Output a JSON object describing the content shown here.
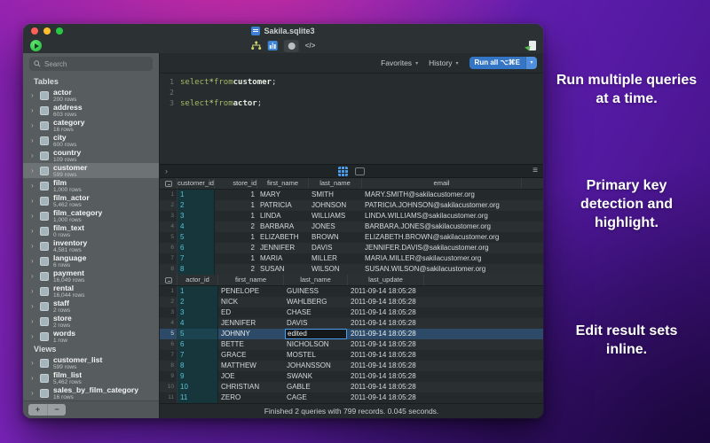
{
  "window": {
    "title": "Sakila.sqlite3"
  },
  "toolbar": {
    "code_label": "</>"
  },
  "query_toolbar": {
    "favorites_label": "Favorites",
    "history_label": "History",
    "run_all_label": "Run all ⌥⌘E",
    "dropdown_glyph": "▾"
  },
  "sidebar": {
    "search_placeholder": "Search",
    "footer": {
      "add_label": "+",
      "remove_label": "−"
    },
    "sections": [
      {
        "label": "Tables",
        "items": [
          {
            "name": "actor",
            "rows": "200 rows"
          },
          {
            "name": "address",
            "rows": "603 rows"
          },
          {
            "name": "category",
            "rows": "16 rows"
          },
          {
            "name": "city",
            "rows": "600 rows"
          },
          {
            "name": "country",
            "rows": "109 rows"
          },
          {
            "name": "customer",
            "rows": "599 rows",
            "selected": true
          },
          {
            "name": "film",
            "rows": "1,000 rows"
          },
          {
            "name": "film_actor",
            "rows": "5,462 rows"
          },
          {
            "name": "film_category",
            "rows": "1,000 rows"
          },
          {
            "name": "film_text",
            "rows": "0 rows"
          },
          {
            "name": "inventory",
            "rows": "4,581 rows"
          },
          {
            "name": "language",
            "rows": "6 rows"
          },
          {
            "name": "payment",
            "rows": "16,049 rows"
          },
          {
            "name": "rental",
            "rows": "16,044 rows"
          },
          {
            "name": "staff",
            "rows": "2 rows"
          },
          {
            "name": "store",
            "rows": "2 rows"
          },
          {
            "name": "words",
            "rows": "1 row"
          }
        ]
      },
      {
        "label": "Views",
        "items": [
          {
            "name": "customer_list",
            "rows": "599 rows"
          },
          {
            "name": "film_list",
            "rows": "5,462 rows"
          },
          {
            "name": "sales_by_film_category",
            "rows": "16 rows"
          }
        ]
      }
    ]
  },
  "editor": {
    "lines": [
      {
        "num": "1",
        "tokens": [
          {
            "text": "select ",
            "cls": "kw"
          },
          {
            "text": "* ",
            "cls": "op"
          },
          {
            "text": "from ",
            "cls": "kw"
          },
          {
            "text": "customer",
            "cls": "ident"
          },
          {
            "text": ";",
            "cls": "plain"
          }
        ]
      },
      {
        "num": "2",
        "tokens": []
      },
      {
        "num": "3",
        "tokens": [
          {
            "text": "select ",
            "cls": "kw"
          },
          {
            "text": "* ",
            "cls": "op"
          },
          {
            "text": "from ",
            "cls": "kw"
          },
          {
            "text": "actor",
            "cls": "ident"
          },
          {
            "text": ";",
            "cls": "plain"
          }
        ]
      }
    ]
  },
  "results_strip": {
    "chevron_glyph": "›",
    "hamburger_glyph": "≡"
  },
  "results": [
    {
      "columns": [
        "customer_id",
        "store_id",
        "first_name",
        "last_name",
        "email"
      ],
      "pk_column": 0,
      "rows": [
        [
          "1",
          "1",
          "MARY",
          "SMITH",
          "MARY.SMITH@sakilacustomer.org"
        ],
        [
          "2",
          "1",
          "PATRICIA",
          "JOHNSON",
          "PATRICIA.JOHNSON@sakilacustomer.org"
        ],
        [
          "3",
          "1",
          "LINDA",
          "WILLIAMS",
          "LINDA.WILLIAMS@sakilacustomer.org"
        ],
        [
          "4",
          "2",
          "BARBARA",
          "JONES",
          "BARBARA.JONES@sakilacustomer.org"
        ],
        [
          "5",
          "1",
          "ELIZABETH",
          "BROWN",
          "ELIZABETH.BROWN@sakilacustomer.org"
        ],
        [
          "6",
          "2",
          "JENNIFER",
          "DAVIS",
          "JENNIFER.DAVIS@sakilacustomer.org"
        ],
        [
          "7",
          "1",
          "MARIA",
          "MILLER",
          "MARIA.MILLER@sakilacustomer.org"
        ],
        [
          "8",
          "2",
          "SUSAN",
          "WILSON",
          "SUSAN.WILSON@sakilacustomer.org"
        ]
      ]
    },
    {
      "columns": [
        "actor_id",
        "first_name",
        "last_name",
        "last_update"
      ],
      "pk_column": 0,
      "selected_row": 4,
      "editing": {
        "row": 4,
        "col": 2,
        "value": "edited"
      },
      "rows": [
        [
          "1",
          "PENELOPE",
          "GUINESS",
          "2011-09-14 18:05:28"
        ],
        [
          "2",
          "NICK",
          "WAHLBERG",
          "2011-09-14 18:05:28"
        ],
        [
          "3",
          "ED",
          "CHASE",
          "2011-09-14 18:05:28"
        ],
        [
          "4",
          "JENNIFER",
          "DAVIS",
          "2011-09-14 18:05:28"
        ],
        [
          "5",
          "JOHNNY",
          "edited",
          "2011-09-14 18:05:28"
        ],
        [
          "6",
          "BETTE",
          "NICHOLSON",
          "2011-09-14 18:05:28"
        ],
        [
          "7",
          "GRACE",
          "MOSTEL",
          "2011-09-14 18:05:28"
        ],
        [
          "8",
          "MATTHEW",
          "JOHANSSON",
          "2011-09-14 18:05:28"
        ],
        [
          "9",
          "JOE",
          "SWANK",
          "2011-09-14 18:05:28"
        ],
        [
          "10",
          "CHRISTIAN",
          "GABLE",
          "2011-09-14 18:05:28"
        ],
        [
          "11",
          "ZERO",
          "CAGE",
          "2011-09-14 18:05:28"
        ]
      ]
    }
  ],
  "status_bar": {
    "text": "Finished 2 queries with 799 records. 0.045 seconds."
  },
  "marketing": [
    {
      "lines": [
        "Run multiple queries",
        "at a time."
      ]
    },
    {
      "lines": [
        "Primary key",
        "detection and",
        "highlight."
      ]
    },
    {
      "lines": [
        "Edit result sets",
        "inline."
      ]
    }
  ],
  "colors": {
    "accent_blue": "#3475c6",
    "pk_cell_bg": "#17363c",
    "pk_text": "#59c4d2",
    "selected_row_bg": "#2d4b68",
    "edit_border": "#4da0f0",
    "background_purple": "#7023bd",
    "background_magenta": "#d12d9a"
  }
}
